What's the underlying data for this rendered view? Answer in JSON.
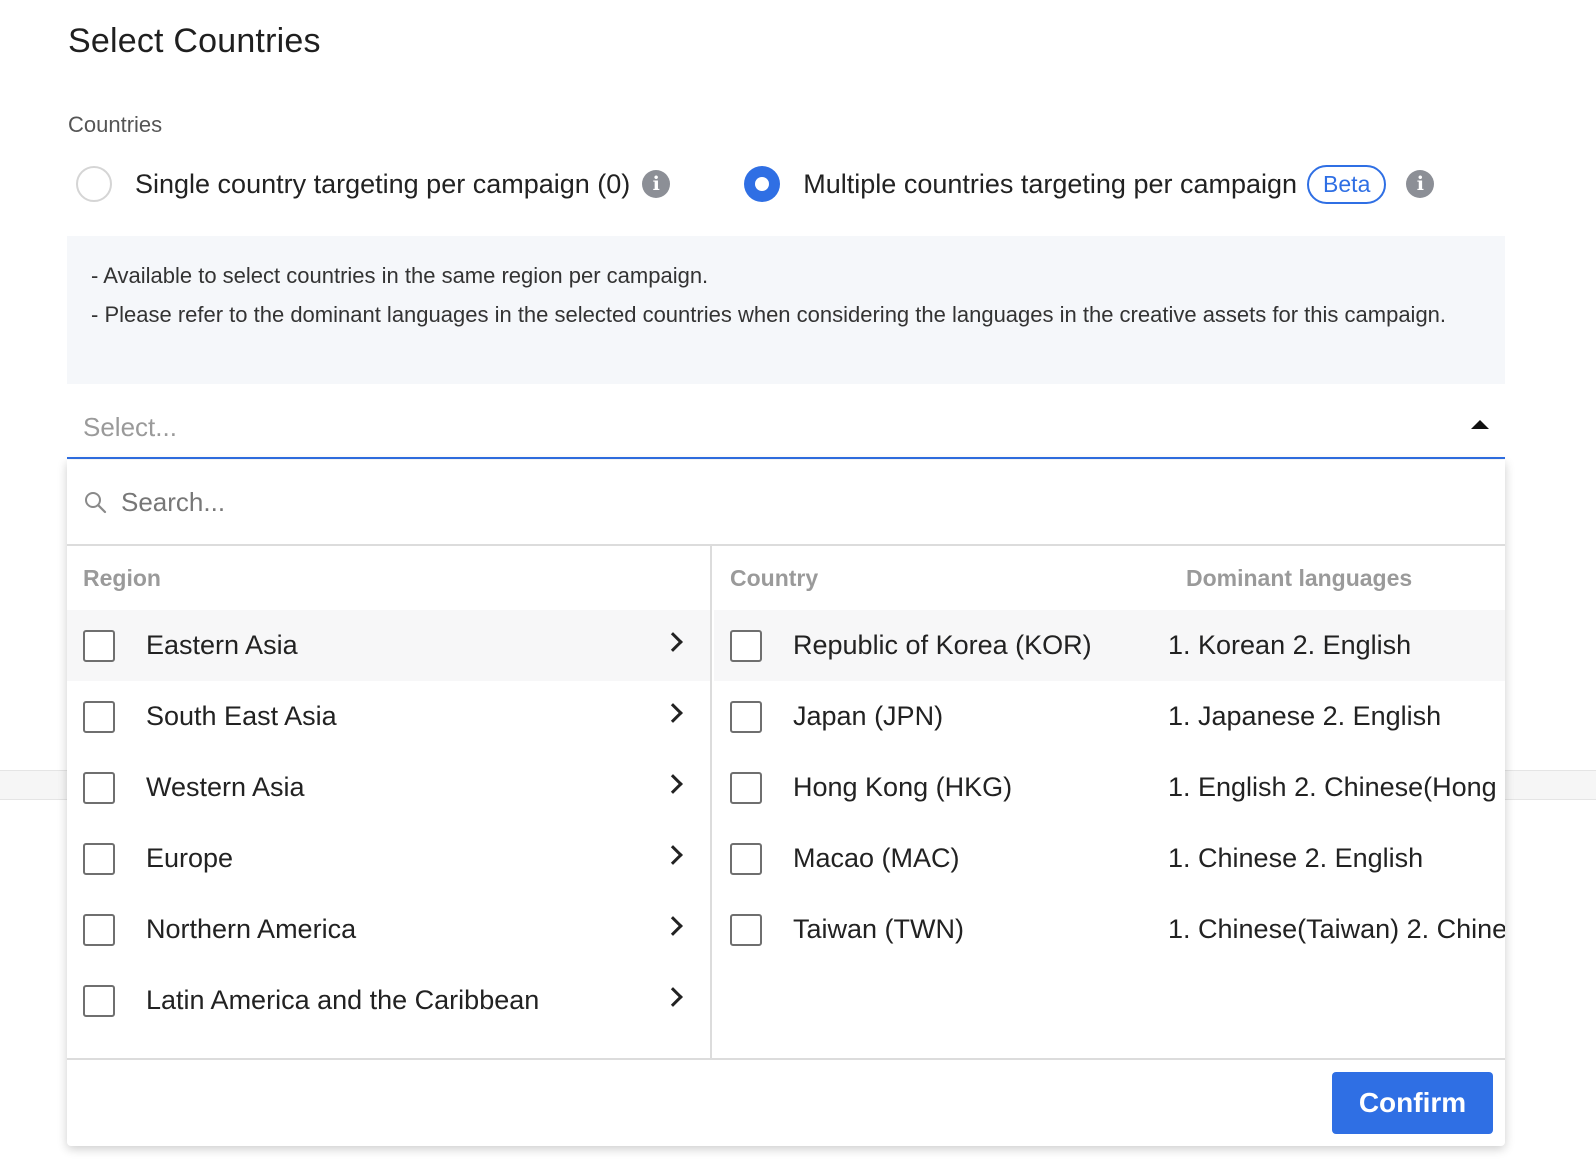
{
  "page": {
    "title": "Select Countries",
    "section_label": "Countries"
  },
  "targeting": {
    "single_label": "Single country targeting per campaign (0)",
    "single_checked": false,
    "multiple_label": "Multiple countries targeting per campaign",
    "multiple_checked": true,
    "beta_badge": "Beta",
    "accent_color": "#2f6fe4"
  },
  "notice": {
    "line1": "- Available to select countries in the same region per campaign.",
    "line2": "- Please refer to the dominant languages in the selected countries when considering the languages in the creative assets for this campaign."
  },
  "select": {
    "placeholder": "Select...",
    "caret_icon": "caret-up-icon"
  },
  "dropdown": {
    "search_placeholder": "Search...",
    "region_header": "Region",
    "country_header": "Country",
    "languages_header": "Dominant languages",
    "regions": [
      {
        "label": "Eastern Asia",
        "active": true
      },
      {
        "label": "South East Asia",
        "active": false
      },
      {
        "label": "Western Asia",
        "active": false
      },
      {
        "label": "Europe",
        "active": false
      },
      {
        "label": "Northern America",
        "active": false
      },
      {
        "label": "Latin America and the Caribbean",
        "active": false
      }
    ],
    "countries": [
      {
        "name": "Republic of Korea (KOR)",
        "languages": "1. Korean 2. English"
      },
      {
        "name": "Japan (JPN)",
        "languages": "1. Japanese 2. English"
      },
      {
        "name": "Hong Kong (HKG)",
        "languages": "1. English 2. Chinese(Hong"
      },
      {
        "name": "Macao (MAC)",
        "languages": "1. Chinese 2. English"
      },
      {
        "name": "Taiwan (TWN)",
        "languages": "1. Chinese(Taiwan) 2. Chine"
      }
    ],
    "confirm_label": "Confirm"
  }
}
